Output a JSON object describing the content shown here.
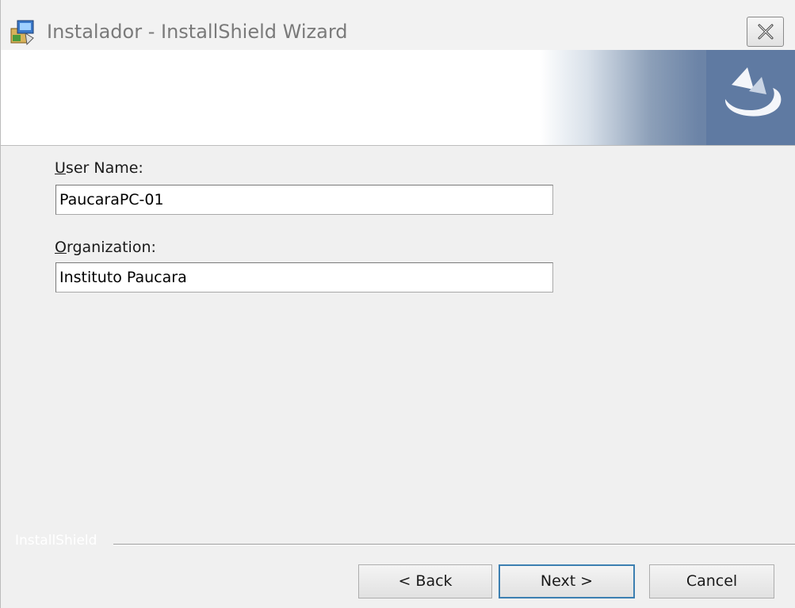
{
  "window": {
    "title": "Instalador - InstallShield Wizard"
  },
  "icons": {
    "app": "installer-package-icon",
    "close": "close-icon",
    "banner_logo": "installshield-logo-icon"
  },
  "form": {
    "user_name_label_accel": "U",
    "user_name_label_rest": "ser Name:",
    "user_name_value": "PaucaraPC-01",
    "organization_label_accel": "O",
    "organization_label_rest": "rganization:",
    "organization_value": "Instituto Paucara"
  },
  "footer": {
    "brand": "InstallShield",
    "back_label": "< Back",
    "next_label": "Next >",
    "cancel_label": "Cancel"
  },
  "colors": {
    "banner_accent": "#5f7aa2",
    "default_button_border": "#3c7fb1"
  }
}
